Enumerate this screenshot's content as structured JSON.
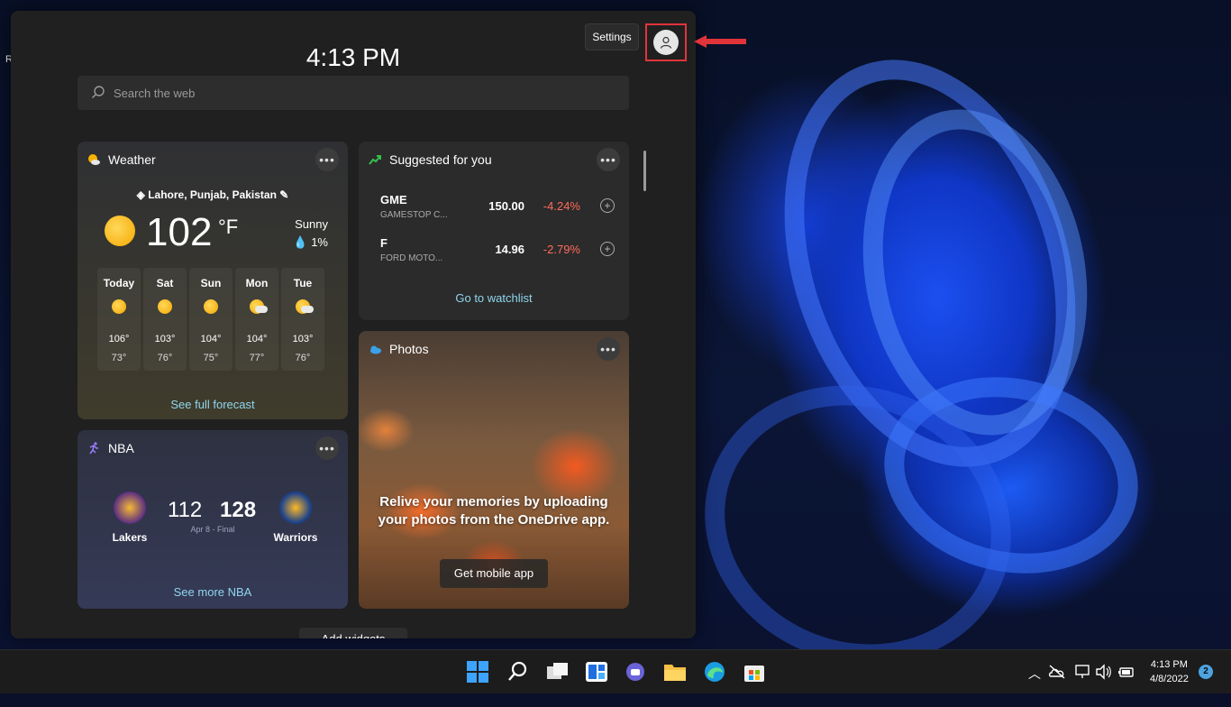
{
  "desktop": {
    "label": "R"
  },
  "widgets_panel": {
    "time": "4:13 PM",
    "settings_tooltip": "Settings",
    "search": {
      "placeholder": "Search the web",
      "value": ""
    },
    "add_widgets": "Add widgets"
  },
  "weather": {
    "title": "Weather",
    "location": "Lahore, Punjab, Pakistan",
    "temperature": "102",
    "unit": "°F",
    "condition": "Sunny",
    "precipitation": "1%",
    "forecast": [
      {
        "day": "Today",
        "high": "106°",
        "low": "73°",
        "icon": "sunny-icon"
      },
      {
        "day": "Sat",
        "high": "103°",
        "low": "76°",
        "icon": "sunny-icon"
      },
      {
        "day": "Sun",
        "high": "104°",
        "low": "75°",
        "icon": "sunny-icon"
      },
      {
        "day": "Mon",
        "high": "104°",
        "low": "77°",
        "icon": "partly-cloudy-icon"
      },
      {
        "day": "Tue",
        "high": "103°",
        "low": "76°",
        "icon": "partly-cloudy-icon"
      }
    ],
    "link": "See full forecast"
  },
  "stocks": {
    "title": "Suggested for you",
    "rows": [
      {
        "symbol": "GME",
        "name": "GAMESTOP C...",
        "price": "150.00",
        "change": "-4.24%"
      },
      {
        "symbol": "F",
        "name": "FORD MOTO...",
        "price": "14.96",
        "change": "-2.79%"
      }
    ],
    "link": "Go to watchlist",
    "change_color": "#ff6b5b"
  },
  "photos": {
    "title": "Photos",
    "message": "Relive your memories by uploading your photos from the OneDrive app.",
    "button": "Get mobile app"
  },
  "nba": {
    "title": "NBA",
    "home": {
      "name": "Lakers",
      "score": "112"
    },
    "away": {
      "name": "Warriors",
      "score": "128"
    },
    "game_info": "Apr 8 - Final",
    "link": "See more NBA"
  },
  "taskbar": {
    "time": "4:13 PM",
    "date": "4/8/2022",
    "notification_count": "2"
  }
}
